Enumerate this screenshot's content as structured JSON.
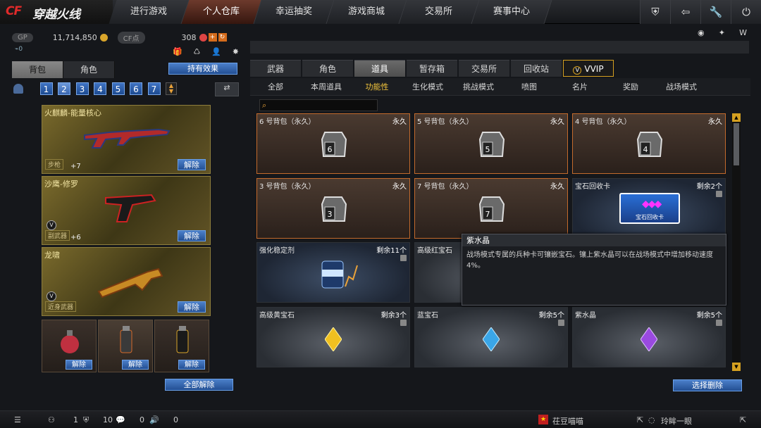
{
  "header": {
    "logo_cf": "CF",
    "logo_text": "穿越火线",
    "nav": [
      "进行游戏",
      "个人仓库",
      "幸运抽奖",
      "游戏商城",
      "交易所",
      "赛事中心"
    ],
    "active_nav_index": 1,
    "icons": [
      "shield-icon",
      "back-icon",
      "wrench-icon",
      "power-icon"
    ]
  },
  "left": {
    "gp_label": "GP",
    "gp_value": "11,714,850",
    "cf_label": "CF点",
    "cf_value": "308",
    "small_counter": "0",
    "tabs": [
      "背包",
      "角色"
    ],
    "active_effect_button": "持有效果",
    "pages": [
      "1",
      "2",
      "3",
      "4",
      "5",
      "6",
      "7"
    ],
    "active_page": "2",
    "weapons": [
      {
        "name": "火麒麟-能量核心",
        "category": "步枪",
        "level": "+7",
        "remove": "解除"
      },
      {
        "name": "沙鹰-修罗",
        "category": "副武器",
        "level": "+6",
        "remove": "解除"
      },
      {
        "name": "龙啸",
        "category": "近身武器",
        "level": "",
        "remove": "解除"
      }
    ],
    "grenades": [
      {
        "remove": "解除"
      },
      {
        "remove": "解除"
      },
      {
        "remove": "解除"
      }
    ],
    "remove_all": "全部解除"
  },
  "right": {
    "tabs": [
      "武器",
      "角色",
      "道具",
      "暂存箱",
      "交易所",
      "回收站",
      "VVIP"
    ],
    "active_tab": "道具",
    "subtabs": [
      "全部",
      "本周道具",
      "功能性",
      "生化模式",
      "挑战模式",
      "喷图",
      "名片",
      "奖励",
      "战场模式"
    ],
    "active_subtab": "功能性",
    "items": [
      {
        "name": "6 号背包（永久）",
        "right": "永久",
        "icon": "6"
      },
      {
        "name": "5 号背包（永久）",
        "right": "永久",
        "icon": "5"
      },
      {
        "name": "4 号背包（永久）",
        "right": "永久",
        "icon": "4"
      },
      {
        "name": "3 号背包（永久）",
        "right": "永久",
        "icon": "3"
      },
      {
        "name": "7 号背包（永久）",
        "right": "永久",
        "icon": "7"
      },
      {
        "name": "宝石回收卡",
        "right": "剩余2个",
        "icon": "宝石回收卡"
      },
      {
        "name": "强化稳定剂",
        "right": "剩余11个"
      },
      {
        "name": "高级红宝石",
        "right": ""
      },
      {
        "name": "",
        "right": ""
      },
      {
        "name": "高级黄宝石",
        "right": "剩余3个"
      },
      {
        "name": "蓝宝石",
        "right": "剩余5个"
      },
      {
        "name": "紫水晶",
        "right": "剩余5个"
      }
    ],
    "tooltip": {
      "title": "紫水晶",
      "desc": "战场模式专属的兵种卡可镶嵌宝石。镶上紫水晶可以在战场模式中增加移动速度4%。"
    },
    "select_delete": "选择删除"
  },
  "bottom": {
    "count1": "1",
    "count2": "10",
    "count3": "0",
    "count4": "0",
    "user1": "茌豆喵喵",
    "user2": "玲眸一眼"
  },
  "colors": {
    "accent": "#c36a2c",
    "blue_button": "#234f93",
    "gold": "#d5a020"
  }
}
